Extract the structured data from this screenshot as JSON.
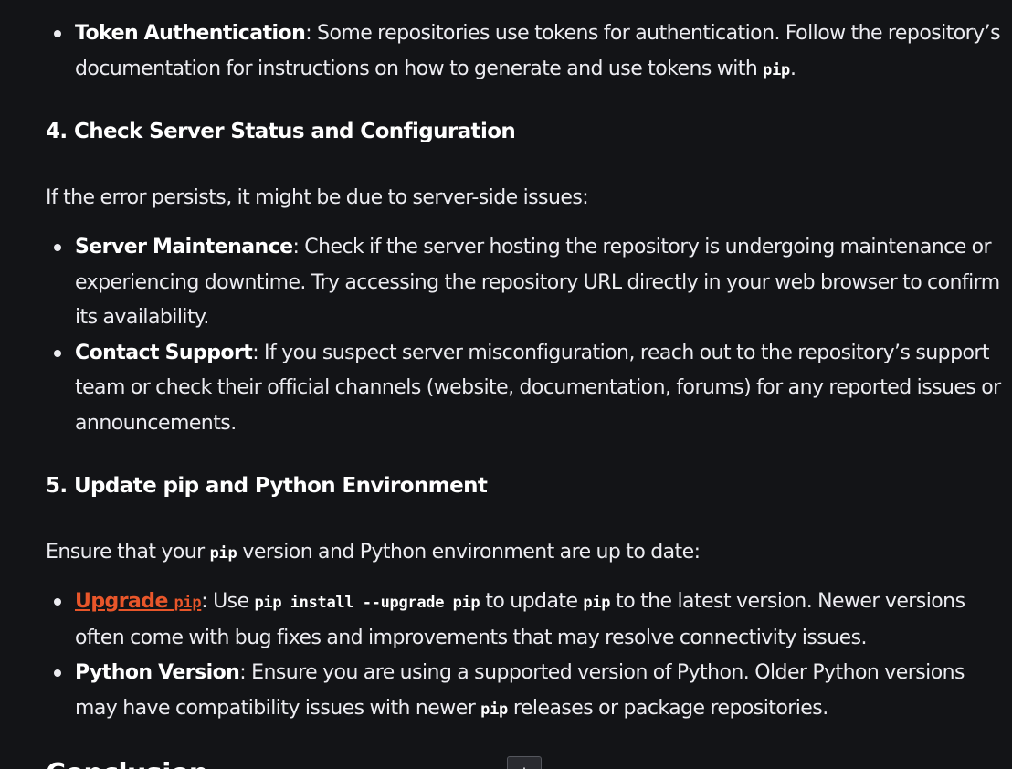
{
  "token_bullet": {
    "title": "Token Authentication",
    "text_1": ": Some repositories use tokens for authentication. Follow the repository’s documentation for instructions on how to generate and use tokens with ",
    "code_1": "pip",
    "text_2": "."
  },
  "section_4": {
    "heading": "4. Check Server Status and Configuration",
    "intro": "If the error persists, it might be due to server-side issues:",
    "bullets": [
      {
        "title": "Server Maintenance",
        "text": ": Check if the server hosting the repository is undergoing maintenance or experiencing downtime. Try accessing the repository URL directly in your web browser to confirm its availability."
      },
      {
        "title": "Contact Support",
        "text": ": If you suspect server misconfiguration, reach out to the repository’s support team or check their official channels (website, documentation, forums) for any reported issues or announcements."
      }
    ]
  },
  "section_5": {
    "heading": "5. Update pip and Python Environment",
    "intro_1": "Ensure that your ",
    "intro_code": "pip",
    "intro_2": " version and Python environment are up to date:",
    "upgrade": {
      "link_text": "Upgrade ",
      "link_code": "pip",
      "text_1": ": Use ",
      "code_1": "pip install --upgrade pip",
      "text_2": " to update ",
      "code_2": "pip",
      "text_3": " to the latest version. Newer versions often come with bug fixes and improvements that may resolve connectivity issues."
    },
    "python": {
      "title": "Python Version",
      "text_1": ": Ensure you are using a supported version of Python. Older Python versions may have compatibility issues with newer ",
      "code_1": "pip",
      "text_2": " releases or package repositories."
    }
  },
  "conclusion_heading": "Conclusion",
  "scroll_button_icon": "arrow-down-icon"
}
